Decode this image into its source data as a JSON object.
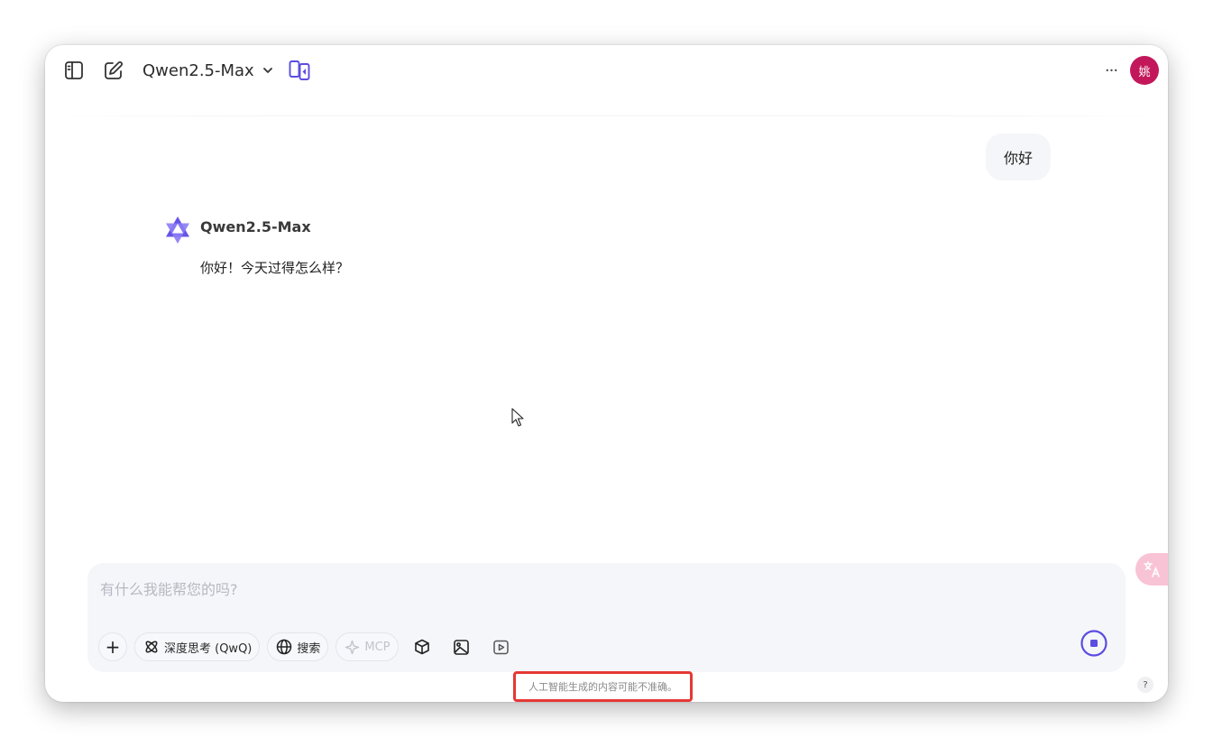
{
  "header": {
    "model_name": "Qwen2.5-Max",
    "avatar_text": "姚",
    "more_label": "···"
  },
  "conversation": {
    "user_message": "你好",
    "assistant_name": "Qwen2.5-Max",
    "assistant_message": "你好！今天过得怎么样？"
  },
  "composer": {
    "placeholder": "有什么我能帮您的吗?",
    "value": "",
    "add_label": "+",
    "deep_think_label": "深度思考 (QwQ)",
    "search_label": "搜索",
    "mcp_label": "MCP"
  },
  "footer": {
    "disclaimer": "人工智能生成的内容可能不准确。",
    "help_label": "?"
  },
  "colors": {
    "accent": "#5b4de0",
    "avatar_bg": "#c2185b",
    "highlight_border": "#e53935",
    "translate_bg": "#f9c3d6"
  },
  "icons": {
    "sidebar": "sidebar-toggle-icon",
    "new_chat": "edit-icon",
    "compare": "compare-icon",
    "deep_think": "atom-icon",
    "search": "globe-icon",
    "mcp": "sparkle-icon",
    "artifact": "cube-icon",
    "image": "image-icon",
    "video": "video-icon",
    "stop": "stop-icon",
    "translate": "translate-icon"
  }
}
